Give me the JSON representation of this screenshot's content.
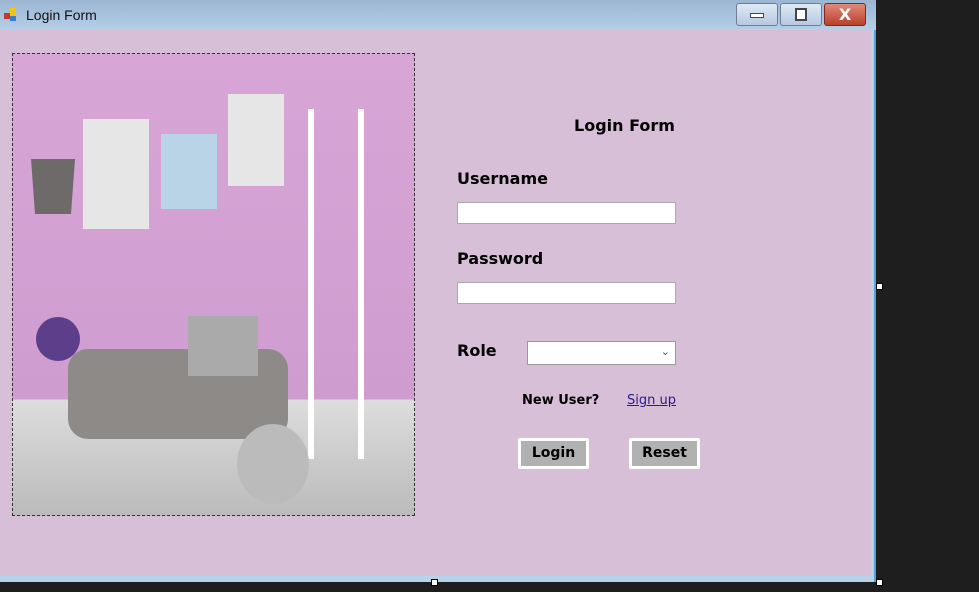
{
  "window": {
    "title": "Login Form",
    "close_glyph": "X"
  },
  "form": {
    "heading": "Login Form",
    "username_label": "Username",
    "username_value": "",
    "password_label": "Password",
    "password_value": "",
    "role_label": "Role",
    "role_value": "",
    "new_user": "New User?",
    "signup": "Sign up",
    "login": "Login",
    "reset": "Reset"
  },
  "colors": {
    "background": "#d8bfd8",
    "button": "#b1b1b1",
    "link": "#2a1a8a"
  }
}
